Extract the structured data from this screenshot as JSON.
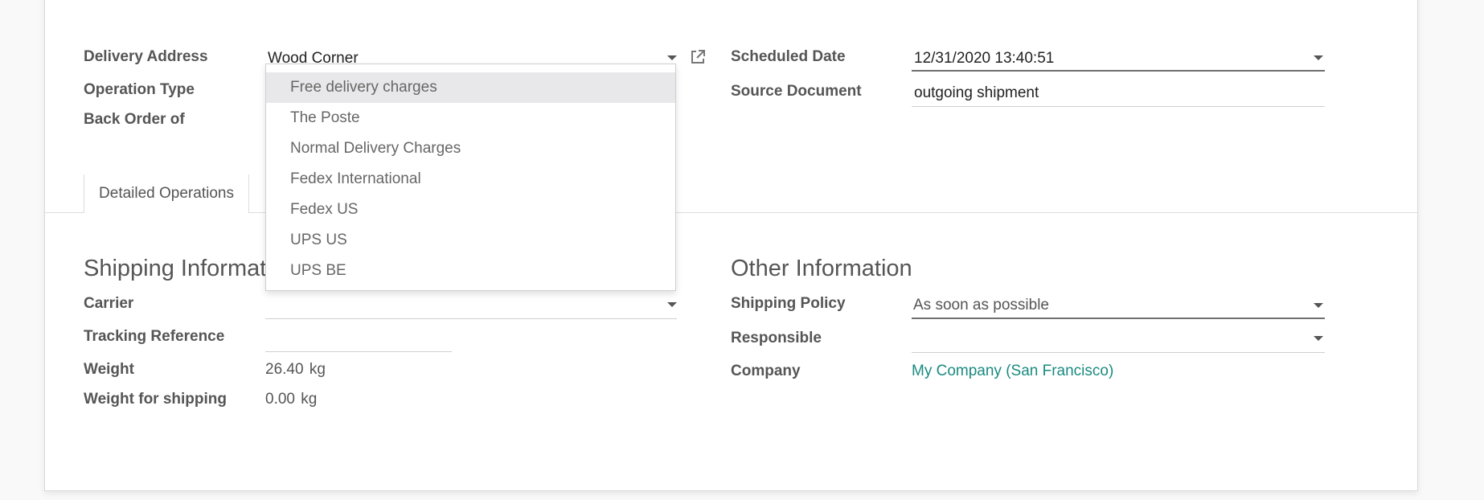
{
  "header": {
    "delivery_address_label": "Delivery Address",
    "delivery_address_value": "Wood Corner",
    "operation_type_label": "Operation Type",
    "back_order_label": "Back Order of",
    "scheduled_date_label": "Scheduled Date",
    "scheduled_date_value": "12/31/2020 13:40:51",
    "source_document_label": "Source Document",
    "source_document_value": "outgoing shipment"
  },
  "tabs": [
    {
      "label": "Detailed Operations"
    }
  ],
  "shipping": {
    "title": "Shipping Informat",
    "carrier_label": "Carrier",
    "tracking_label": "Tracking Reference",
    "weight_label": "Weight",
    "weight_value": "26.40",
    "weight_unit": "kg",
    "weight_shipping_label": "Weight for shipping",
    "weight_shipping_value": "0.00",
    "weight_shipping_unit": "kg"
  },
  "other": {
    "title": "Other Information",
    "shipping_policy_label": "Shipping Policy",
    "shipping_policy_value": "As soon as possible",
    "responsible_label": "Responsible",
    "company_label": "Company",
    "company_value": "My Company (San Francisco)"
  },
  "carrier_dropdown": {
    "options": [
      "Free delivery charges",
      "The Poste",
      "Normal Delivery Charges",
      "Fedex International",
      "Fedex US",
      "UPS US",
      "UPS BE"
    ]
  },
  "colors": {
    "link": "#1a8a80",
    "highlight": "#e8e8ea"
  },
  "icons": {
    "external_link": "external-link-icon",
    "dropdown_caret": "caret-down-icon"
  }
}
